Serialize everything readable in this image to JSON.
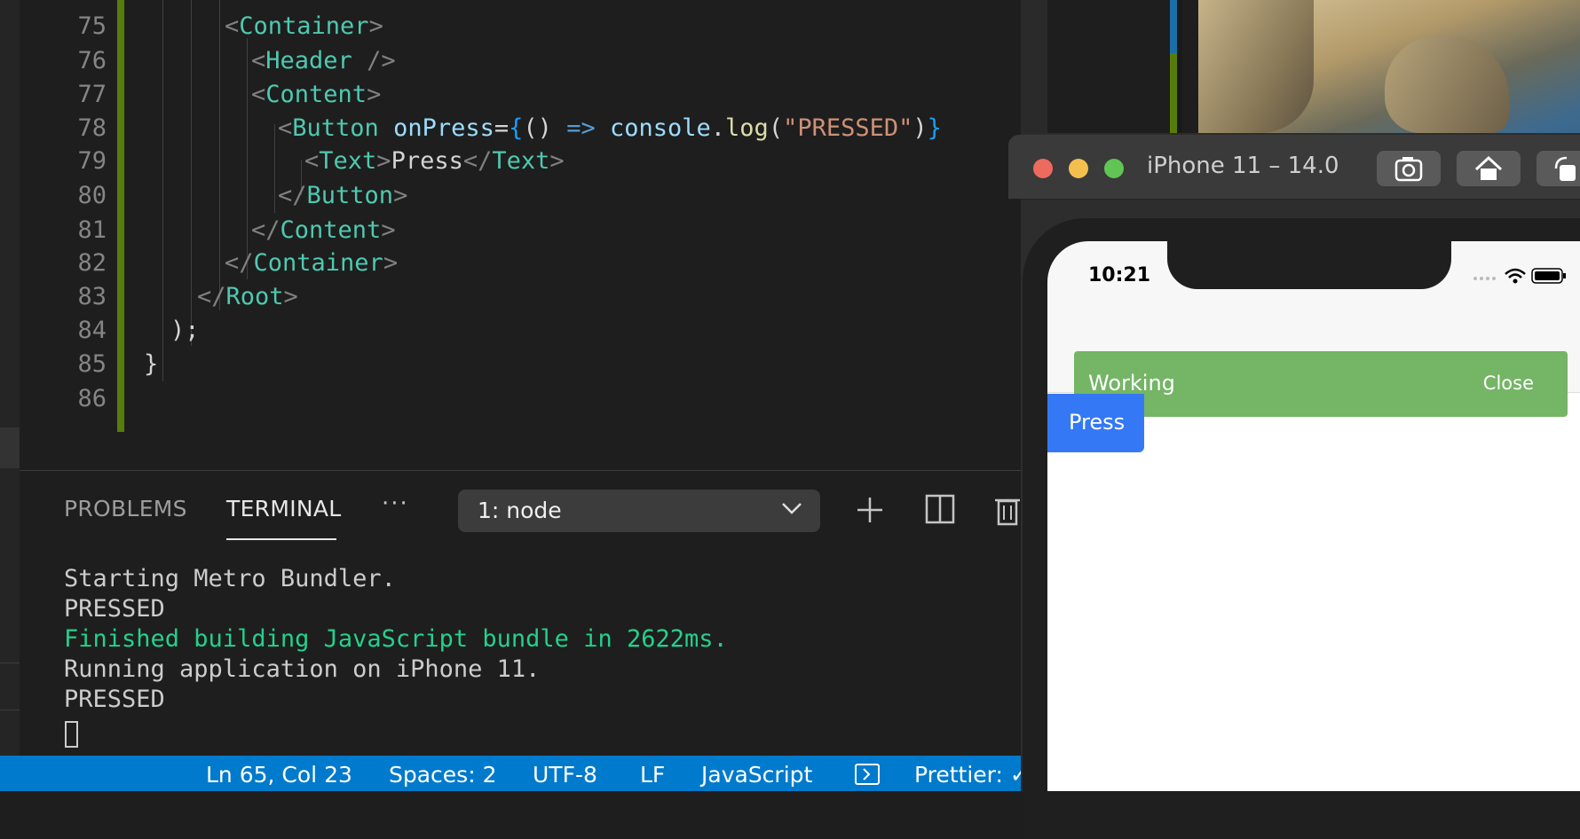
{
  "editor": {
    "lines": [
      {
        "n": "75"
      },
      {
        "n": "76"
      },
      {
        "n": "77"
      },
      {
        "n": "78"
      },
      {
        "n": "79"
      },
      {
        "n": "80"
      },
      {
        "n": "81"
      },
      {
        "n": "82"
      },
      {
        "n": "83"
      },
      {
        "n": "84"
      },
      {
        "n": "85"
      },
      {
        "n": "86"
      }
    ],
    "code": {
      "l75_tag": "Container",
      "l76_tag": "Header",
      "l77_tag": "Content",
      "l78_tag": "Button",
      "l78_attr": "onPress",
      "l78_fn_obj": "console",
      "l78_fn": "log",
      "l78_str": "\"PRESSED\"",
      "l79_tag": "Text",
      "l79_text": "Press",
      "l80_tag": "Button",
      "l81_tag": "Content",
      "l82_tag": "Container",
      "l83_tag": "Root",
      "l84_text": ");",
      "l85_text": "}"
    }
  },
  "panel": {
    "tabs": [
      "PROBLEMS",
      "TERMINAL"
    ],
    "more": "···",
    "terminal_select": "1: node",
    "output": [
      {
        "text": "Starting Metro Bundler.",
        "color": "#cccccc"
      },
      {
        "text": "PRESSED",
        "color": "#cccccc"
      },
      {
        "text": "Finished building JavaScript bundle in 2622ms.",
        "color": "#23d18b"
      },
      {
        "text": "Running application on iPhone 11.",
        "color": "#cccccc"
      },
      {
        "text": "PRESSED",
        "color": "#cccccc"
      }
    ]
  },
  "statusbar": {
    "position": "Ln 65, Col 23",
    "spaces": "Spaces: 2",
    "encoding": "UTF-8",
    "eol": "LF",
    "language": "JavaScript",
    "prettier": "Prettier: ✓",
    "color": "#007acc"
  },
  "simulator": {
    "title": "iPhone 11 – 14.0",
    "time": "10:21",
    "toast": {
      "text": "Working",
      "close": "Close",
      "color": "#74b566"
    },
    "button": {
      "label": "Press",
      "color": "#3478f6"
    }
  }
}
